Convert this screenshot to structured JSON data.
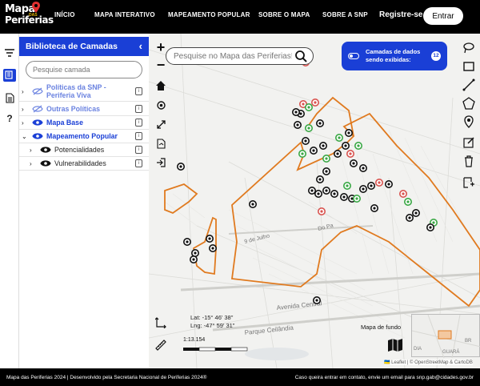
{
  "header": {
    "logo_line1": "Mapa",
    "logo_dos": "DAS",
    "logo_line2": "Periferias",
    "nav": [
      "INÍCIO",
      "MAPA INTERATIVO",
      "MAPEAMENTO POPULAR",
      "SOBRE O MAPA",
      "SOBRE A SNP"
    ],
    "register": "Registre-se",
    "login": "Entrar"
  },
  "panel": {
    "title": "Biblioteca de Camadas",
    "close": "‹",
    "search_placeholder": "Pesquise camada",
    "layers": [
      {
        "label": "Políticas da SNP - Periferia Viva",
        "expanded": false,
        "visible": false,
        "style": "light"
      },
      {
        "label": "Outras Políticas",
        "expanded": false,
        "visible": false,
        "style": "light"
      },
      {
        "label": "Mapa Base",
        "expanded": false,
        "visible": true,
        "style": "blue"
      },
      {
        "label": "Mapeamento Popular",
        "expanded": true,
        "visible": true,
        "style": "blue"
      },
      {
        "label": "Potencialidades",
        "expanded": false,
        "visible": true,
        "style": "child"
      },
      {
        "label": "Vulnerabilidades",
        "expanded": false,
        "visible": true,
        "style": "child"
      }
    ]
  },
  "map": {
    "search_placeholder": "Pesquise no Mapa das Periferias!",
    "data_layers_text_1": "Camadas de dados",
    "data_layers_text_2": "sendo exibidas:",
    "data_layers_count": "12",
    "coords_lat": "Lat: -15° 46' 38\"",
    "coords_lng": "Lng: -47° 59' 31\"",
    "scale": "1:13.154",
    "basemap_label": "Mapa de fundo",
    "street_labels": [
      "Avenida Central",
      "Parque Ceilândia",
      "9 de Julho",
      "Do Pa"
    ],
    "minimap_labels": [
      "DIA",
      "GUARÁ",
      "BR"
    ],
    "attribution": "🇺🇦 Leaflet | © OpenStreetMap & CartoDB"
  },
  "footer": {
    "left": "Mapa das Periferias 2024 | Desenvolvido pela Secretaria Nacional de Periferias 2024®",
    "right": "Caso queira entrar em contato, envie um email para snp.gab@cidades.gov.br"
  },
  "colors": {
    "brand_blue": "#1a3fd6",
    "boundary": "#e07a1f",
    "marker_green": "#3aa845",
    "marker_red": "#d9534f"
  }
}
